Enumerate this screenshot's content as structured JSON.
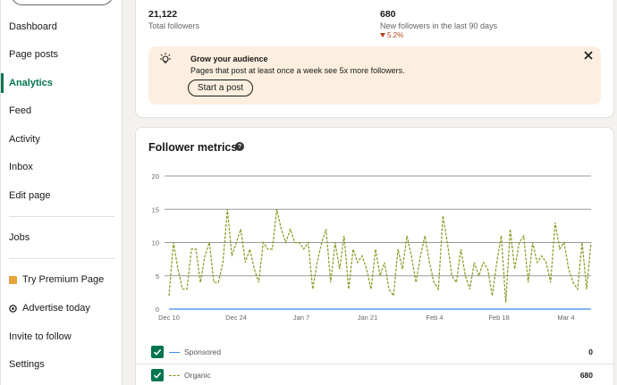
{
  "sidebar": {
    "items": [
      {
        "label": "Dashboard"
      },
      {
        "label": "Page posts"
      },
      {
        "label": "Analytics"
      },
      {
        "label": "Feed"
      },
      {
        "label": "Activity"
      },
      {
        "label": "Inbox"
      },
      {
        "label": "Edit page"
      },
      {
        "label": "Jobs"
      },
      {
        "label": "Try Premium Page"
      },
      {
        "label": "Advertise today"
      },
      {
        "label": "Invite to follow"
      },
      {
        "label": "Settings"
      }
    ],
    "active_item": "Analytics"
  },
  "summary": {
    "total_followers": {
      "value": "21,122",
      "label": "Total followers"
    },
    "new_followers": {
      "value": "680",
      "label": "New followers in the last 90 days",
      "change": "5.2%",
      "direction": "down"
    }
  },
  "banner": {
    "title": "Grow your audience",
    "text": "Pages that post at least once a week see 5x more followers.",
    "button": "Start a post",
    "icon": "lightbulb-icon",
    "close_icon": "close-icon"
  },
  "metrics": {
    "title": "Follower metrics",
    "help_icon": "?",
    "legend": [
      {
        "label": "Sponsored",
        "value": "0",
        "color": "#378fe9",
        "style": "solid",
        "checked": true
      },
      {
        "label": "Organic",
        "value": "680",
        "color": "#7f9b1b",
        "style": "dashed",
        "checked": true
      }
    ]
  },
  "chart_data": {
    "type": "line",
    "ylim": [
      0,
      20
    ],
    "yticks": [
      "0",
      "5",
      "10",
      "15",
      "20"
    ],
    "xlabels": [
      "Dec 10",
      "Dec 24",
      "Jan 7",
      "Jan 21",
      "Feb 4",
      "Feb 18",
      "Mar 4"
    ],
    "grid": true,
    "series": [
      {
        "name": "Sponsored",
        "color": "#378fe9",
        "values": [
          0,
          0,
          0,
          0,
          0,
          0,
          0,
          0,
          0,
          0,
          0,
          0,
          0,
          0,
          0,
          0,
          0,
          0,
          0,
          0,
          0,
          0,
          0,
          0,
          0,
          0,
          0,
          0,
          0,
          0,
          0,
          0,
          0,
          0,
          0,
          0,
          0,
          0,
          0,
          0,
          0,
          0,
          0,
          0,
          0,
          0,
          0,
          0,
          0,
          0,
          0,
          0,
          0,
          0,
          0,
          0,
          0,
          0,
          0,
          0,
          0,
          0,
          0,
          0,
          0,
          0,
          0,
          0,
          0,
          0,
          0,
          0,
          0,
          0,
          0,
          0,
          0,
          0,
          0,
          0,
          0,
          0,
          0,
          0,
          0,
          0,
          0,
          0,
          0,
          0,
          0
        ]
      },
      {
        "name": "Organic",
        "color": "#7f9b1b",
        "values": [
          2,
          10,
          6,
          3,
          3,
          9,
          9,
          4,
          8,
          10,
          4,
          4,
          7,
          15,
          8,
          10,
          12,
          7,
          9,
          6,
          4,
          10,
          9,
          9,
          15,
          12,
          10,
          12,
          10,
          10,
          9,
          10,
          3,
          7,
          10,
          12,
          4,
          10,
          6,
          11,
          3,
          9,
          7,
          8,
          6,
          3,
          9,
          5,
          7,
          3,
          2,
          9,
          6,
          11,
          8,
          4,
          8,
          11,
          7,
          4,
          3,
          14,
          10,
          5,
          4,
          9,
          5,
          3,
          7,
          5,
          7,
          6,
          2,
          7,
          11,
          1,
          12,
          6,
          10,
          11,
          4,
          10,
          7,
          8,
          7,
          4,
          13,
          9,
          10,
          6,
          4,
          3,
          10,
          3,
          10
        ]
      }
    ]
  }
}
